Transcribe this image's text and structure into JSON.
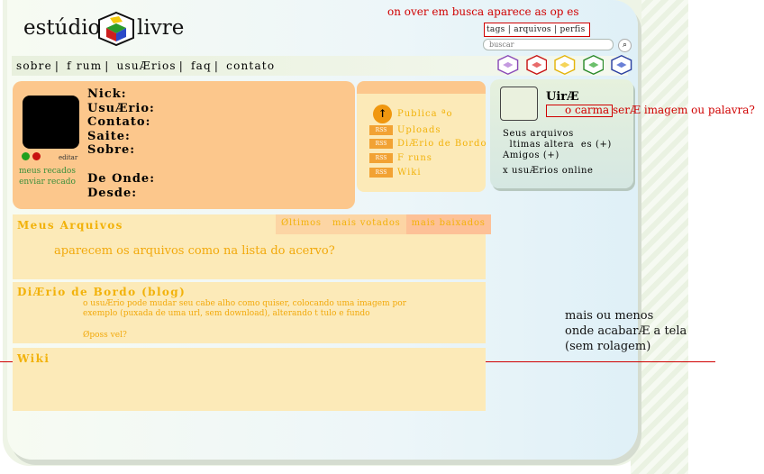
{
  "header": {
    "logo_left": "estúdio",
    "logo_right": "livre",
    "hover_note": "on over em busca aparece as op  es",
    "search_tabs": "tags  |  arquivos  |  perfis",
    "search_placeholder": "buscar",
    "search_button": "⌕"
  },
  "nav": {
    "items": [
      "sobre",
      "f rum",
      "usuÆrios",
      "faq",
      "contato"
    ],
    "separator": "|"
  },
  "profile": {
    "fields": [
      "Nick:",
      "UsuÆrio:",
      "Contato:",
      "Saite:",
      "Sobre:"
    ],
    "fields_bottom": [
      "De Onde:",
      "Desde:"
    ],
    "edit_link": "editar",
    "recados": [
      "meus recados",
      "enviar recado"
    ]
  },
  "actions": {
    "publish": "Publica ªo",
    "items": [
      {
        "badge": "RSS",
        "label": "Uploads"
      },
      {
        "badge": "RSS",
        "label": "DiÆrio de Bordo"
      },
      {
        "badge": "RSS",
        "label": "F runs"
      },
      {
        "badge": "RSS",
        "label": "Wiki"
      }
    ]
  },
  "userbox": {
    "name": "UirÆ",
    "carma": "o carma serÆ imagem ou palavra?",
    "links": [
      "Seus arquivos",
      "  ltimas altera  es (+)",
      "Amigos (+)"
    ],
    "online": "x usuÆrios online"
  },
  "files": {
    "title": "Meus Arquivos",
    "tabs": [
      "Øltimos",
      "mais votados",
      "mais baixados"
    ],
    "body": "aparecem os arquivos como na lista do acervo?"
  },
  "diario": {
    "title": "DiÆrio de Bordo (blog)",
    "note": "o usuÆrio pode mudar seu cabe alho como quiser, colocando uma imagem por exemplo (puxada de uma url, sem download), alterando t tulo e fundo",
    "note2": "Øposs vel?"
  },
  "wiki": {
    "title": "Wiki"
  },
  "side_note": [
    "mais ou menos",
    "onde acabarÆ a tela",
    "(sem rolagem)"
  ],
  "colors": {
    "orange": "#fcc78c",
    "light_yellow": "#fceab8",
    "accent_text": "#f2b20a",
    "annotation": "#d00000"
  },
  "icons": [
    "cube-logo-icon",
    "purple-cube-icon",
    "red-cube-icon",
    "yellow-cube-icon",
    "green-cube-icon",
    "blue-cube-icon",
    "arrow-up-icon",
    "rss-icon",
    "search-icon"
  ]
}
